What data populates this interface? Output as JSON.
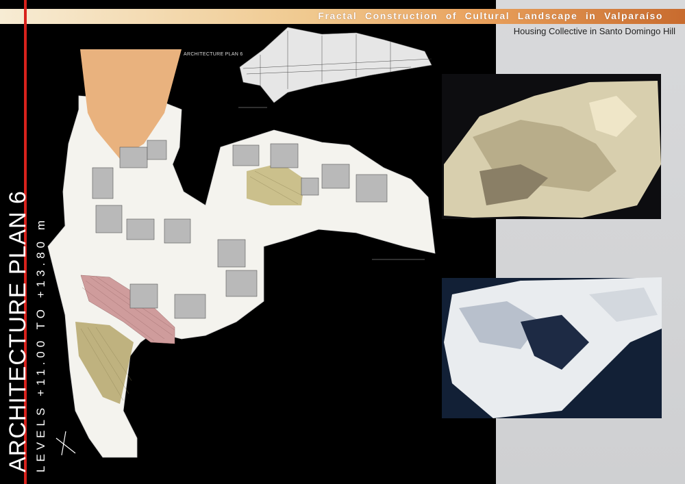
{
  "banner": {
    "title": "Fractal Construction of Cultural Landscape in Valparaíso",
    "subtitle": "Housing Collective in Santo Domingo Hill"
  },
  "sheet": {
    "vertical_title": "ARCHITECTURE PLAN 6",
    "levels": "LEVELS +11.00 TO +13.80 m",
    "section_label": "ARCHITECTURE PLAN 6"
  },
  "colors": {
    "board": "#000000",
    "accent_red": "#d8221c",
    "plaza_orange": "#e9b27e",
    "terrace_pink": "#c98f8f",
    "garden_olive": "#b9ad7a"
  },
  "photos": [
    {
      "name": "model-photo-aerial-1"
    },
    {
      "name": "model-photo-aerial-2"
    }
  ],
  "icons": {
    "north_arrow": "north-arrow-icon"
  }
}
